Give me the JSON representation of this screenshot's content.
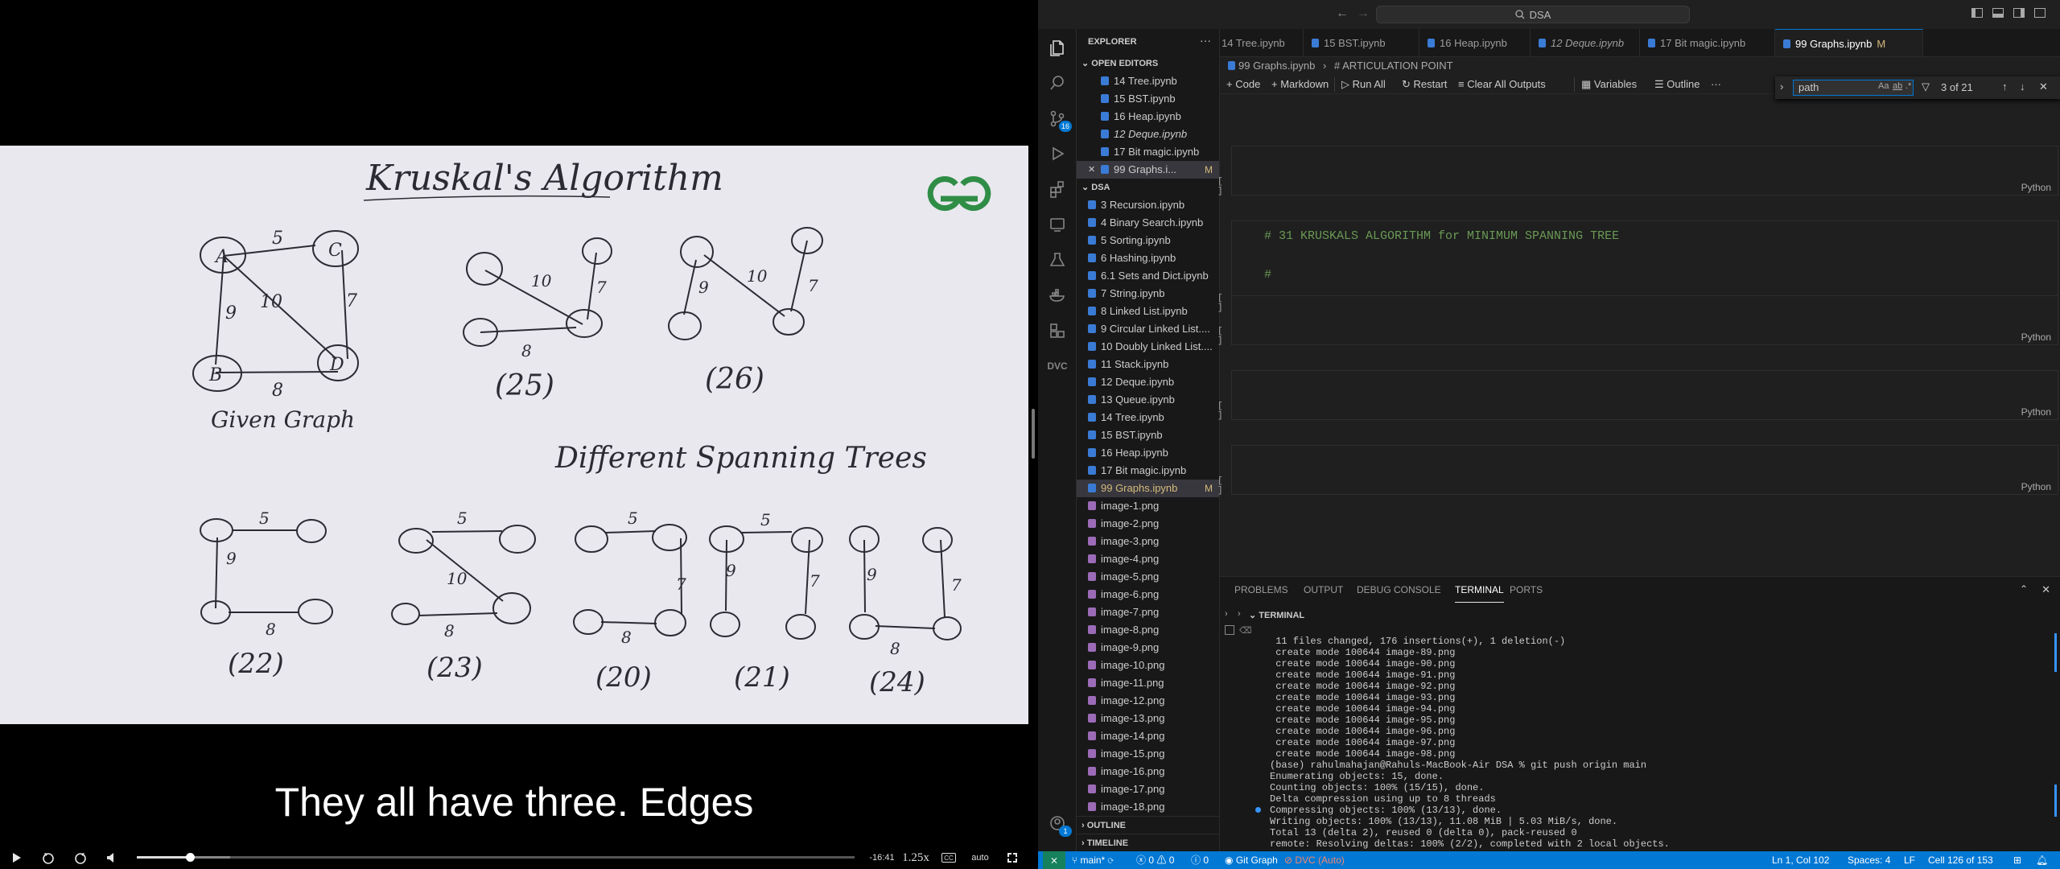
{
  "video": {
    "subtitle": "They all have three. Edges",
    "time_remaining": "-16:41",
    "speed": "1.25x",
    "captions": "CC",
    "quality": "auto",
    "progress": 0.074,
    "buffered": 0.13,
    "board": {
      "title": "Kruskal's Algorithm",
      "caption_given": "Given Graph",
      "caption_spanning": "Different Spanning Trees",
      "logo": "GG",
      "top_trees": [
        {
          "weight": "(25)",
          "edge_labels": [
            "10",
            "7",
            "8"
          ]
        },
        {
          "weight": "(26)",
          "edge_labels": [
            "9",
            "10",
            "7"
          ]
        }
      ],
      "bottom_trees": [
        {
          "weight": "(22)",
          "edge_labels": [
            "5",
            "9",
            "8"
          ]
        },
        {
          "weight": "(23)",
          "edge_labels": [
            "5",
            "10",
            "8"
          ]
        },
        {
          "weight": "(20)",
          "edge_labels": [
            "5",
            "7",
            "8"
          ]
        },
        {
          "weight": "(21)",
          "edge_labels": [
            "5",
            "9",
            "7"
          ]
        },
        {
          "weight": "(24)",
          "edge_labels": [
            "9",
            "7",
            "8"
          ]
        }
      ],
      "given_edge_labels": [
        "5",
        "9",
        "10",
        "7",
        "8"
      ],
      "nodes": [
        "A",
        "B",
        "C",
        "D"
      ]
    }
  },
  "vscode": {
    "command_center": "DSA",
    "source_control_badge": "16",
    "accounts_badge": "1",
    "explorer_title": "EXPLORER",
    "open_editors_title": "OPEN EDITORS",
    "open_editors": [
      {
        "name": "14 Tree.ipynb"
      },
      {
        "name": "15 BST.ipynb"
      },
      {
        "name": "16 Heap.ipynb"
      },
      {
        "name": "12 Deque.ipynb"
      },
      {
        "name": "17 Bit magic.ipynb"
      },
      {
        "name": "99 Graphs.i...",
        "modified": "M"
      }
    ],
    "folder_title": "DSA",
    "files": [
      "3 Recursion.ipynb",
      "4 Binary Search.ipynb",
      "5 Sorting.ipynb",
      "6 Hashing.ipynb",
      "6.1 Sets and Dict.ipynb",
      "7 String.ipynb",
      "8 Linked List.ipynb",
      "9 Circular Linked List....",
      "10 Doubly Linked List....",
      "11 Stack.ipynb",
      "12 Deque.ipynb",
      "13 Queue.ipynb",
      "14 Tree.ipynb",
      "15 BST.ipynb",
      "16 Heap.ipynb",
      "17 Bit magic.ipynb",
      "99 Graphs.ipynb",
      "image-1.png",
      "image-2.png",
      "image-3.png",
      "image-4.png",
      "image-5.png",
      "image-6.png",
      "image-7.png",
      "image-8.png",
      "image-9.png",
      "image-10.png",
      "image-11.png",
      "image-12.png",
      "image-13.png",
      "image-14.png",
      "image-15.png",
      "image-16.png",
      "image-17.png",
      "image-18.png"
    ],
    "active_file_modified": "M",
    "outline_title": "OUTLINE",
    "timeline_title": "TIMELINE",
    "tabs": [
      "14 Tree.ipynb",
      "15 BST.ipynb",
      "16 Heap.ipynb",
      "12 Deque.ipynb",
      "17 Bit magic.ipynb",
      "99 Graphs.ipynb"
    ],
    "active_tab_modified": "M",
    "breadcrumb": {
      "file": "99 Graphs.ipynb",
      "symbol": "# ARTICULATION POINT"
    },
    "toolbar": {
      "code": "Code",
      "markdown": "Markdown",
      "run_all": "Run All",
      "restart": "Restart",
      "clear": "Clear All Outputs",
      "variables": "Variables",
      "outline": "Outline",
      "more": "···"
    },
    "find": {
      "value": "path",
      "aa": "Aa",
      "ab": "ab",
      "regex": ".*",
      "count": "3 of 21"
    },
    "cells": [
      {
        "run": "[ ]",
        "lang": "Python",
        "text1": "",
        "text2": ""
      },
      {
        "run": "[ ]",
        "lang": "Python",
        "text1": "# 31 KRUSKALS ALGORITHM for MINIMUM SPANNING TREE",
        "text2": "#"
      },
      {
        "run": "[ ]",
        "lang": "Python",
        "text1": "",
        "text2": ""
      },
      {
        "run": "[ ]",
        "lang": "Python",
        "text1": "",
        "text2": ""
      },
      {
        "run": "[ ]",
        "lang": "Python",
        "text1": "",
        "text2": ""
      }
    ],
    "panel_tabs": [
      "PROBLEMS",
      "OUTPUT",
      "DEBUG CONSOLE",
      "TERMINAL",
      "PORTS"
    ],
    "terminal_title": "TERMINAL",
    "terminal_lines": [
      " 11 files changed, 176 insertions(+), 1 deletion(-)",
      " create mode 100644 image-89.png",
      " create mode 100644 image-90.png",
      " create mode 100644 image-91.png",
      " create mode 100644 image-92.png",
      " create mode 100644 image-93.png",
      " create mode 100644 image-94.png",
      " create mode 100644 image-95.png",
      " create mode 100644 image-96.png",
      " create mode 100644 image-97.png",
      " create mode 100644 image-98.png",
      "(base) rahulmahajan@Rahuls-MacBook-Air DSA % git push origin main",
      "Enumerating objects: 15, done.",
      "Counting objects: 100% (15/15), done.",
      "Delta compression using up to 8 threads",
      "Compressing objects: 100% (13/13), done.",
      "Writing objects: 100% (13/13), 11.08 MiB | 5.03 MiB/s, done.",
      "Total 13 (delta 2), reused 0 (delta 0), pack-reused 0",
      "remote: Resolving deltas: 100% (2/2), completed with 2 local objects."
    ],
    "status": {
      "branch": "main*",
      "errors": "0",
      "warnings": "0",
      "info": "0",
      "git_graph": "Git Graph",
      "dvc": "DVC (Auto)",
      "position": "Ln 1, Col 102",
      "spaces": "Spaces: 4",
      "eol": "LF",
      "cell": "Cell 126 of 153"
    }
  }
}
